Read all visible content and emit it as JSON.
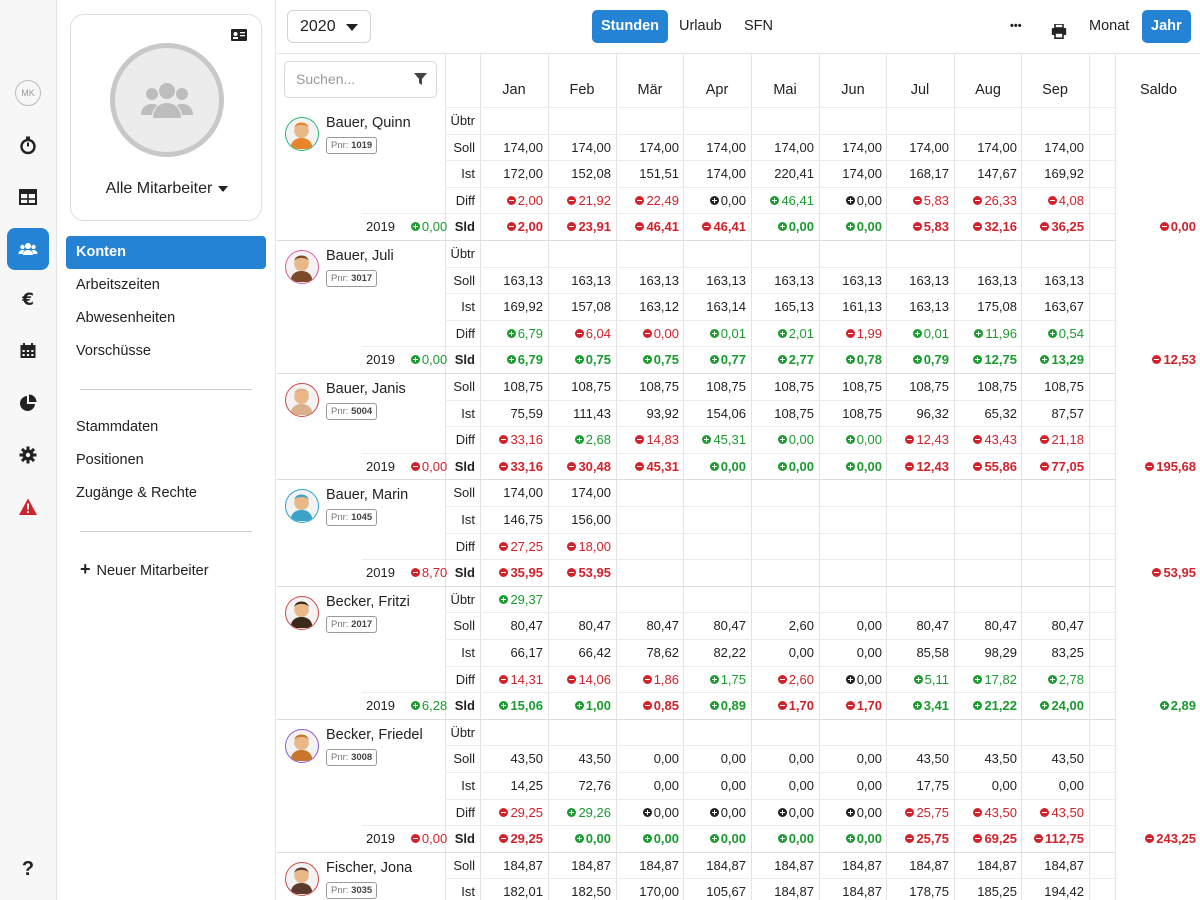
{
  "rail": {
    "avatar_initials": "MK",
    "items": [
      {
        "icon": "stopwatch-icon"
      },
      {
        "icon": "table-icon"
      },
      {
        "icon": "users-icon",
        "active": true
      },
      {
        "icon": "euro-icon"
      },
      {
        "icon": "calendar-icon"
      },
      {
        "icon": "pie-chart-icon"
      },
      {
        "icon": "gear-icon"
      },
      {
        "icon": "warning-icon"
      }
    ],
    "help_label": "?"
  },
  "side": {
    "group_label": "Alle Mitarbeiter",
    "nav": [
      {
        "label": "Konten",
        "active": true
      },
      {
        "label": "Arbeitszeiten"
      },
      {
        "label": "Abwesenheiten"
      },
      {
        "label": "Vorschüsse"
      }
    ],
    "nav2": [
      {
        "label": "Stammdaten"
      },
      {
        "label": "Positionen"
      },
      {
        "label": "Zugänge & Rechte"
      }
    ],
    "new_employee_label": "Neuer Mitarbeiter"
  },
  "topbar": {
    "year": "2020",
    "tabs": [
      {
        "label": "Stunden",
        "active": true
      },
      {
        "label": "Urlaub"
      },
      {
        "label": "SFN"
      }
    ],
    "more_label": "•••",
    "view_month_label": "Monat",
    "view_year_label": "Jahr"
  },
  "table": {
    "search_placeholder": "Suchen...",
    "months": [
      "Jan",
      "Feb",
      "Mär",
      "Apr",
      "Mai",
      "Jun",
      "Jul",
      "Aug",
      "Sep",
      "O"
    ],
    "saldo_label": "Saldo",
    "row_labels": {
      "ubtr": "Übtr",
      "soll": "Soll",
      "ist": "Ist",
      "diff": "Diff",
      "sld": "Sld"
    },
    "employees": [
      {
        "name": "Bauer, Quinn",
        "pnr_label": "Pnr:",
        "pnr": "1019",
        "avatar_color": "#e8852a",
        "prev_year": "2019",
        "prev_value": "0,00",
        "prev_sign": "pos",
        "rows": {
          "ubtr": [],
          "soll": [
            "174,00",
            "174,00",
            "174,00",
            "174,00",
            "174,00",
            "174,00",
            "174,00",
            "174,00",
            "174,00"
          ],
          "ist": [
            "172,00",
            "152,08",
            "151,51",
            "174,00",
            "220,41",
            "174,00",
            "168,17",
            "147,67",
            "169,92"
          ],
          "diff": [
            [
              "neg",
              "2,00"
            ],
            [
              "neg",
              "21,92"
            ],
            [
              "neg",
              "22,49"
            ],
            [
              "neutral",
              "0,00"
            ],
            [
              "pos",
              "46,41"
            ],
            [
              "neutral",
              "0,00"
            ],
            [
              "neg",
              "5,83"
            ],
            [
              "neg",
              "26,33"
            ],
            [
              "neg",
              "4,08"
            ],
            [
              "pos",
              ""
            ]
          ],
          "sld": [
            [
              "neg",
              "2,00"
            ],
            [
              "neg",
              "23,91"
            ],
            [
              "neg",
              "46,41"
            ],
            [
              "neg",
              "46,41"
            ],
            [
              "pos",
              "0,00"
            ],
            [
              "pos",
              "0,00"
            ],
            [
              "neg",
              "5,83"
            ],
            [
              "neg",
              "32,16"
            ],
            [
              "neg",
              "36,25"
            ]
          ]
        },
        "saldo": [
          "neg",
          "0,00"
        ]
      },
      {
        "name": "Bauer, Juli",
        "pnr_label": "Pnr:",
        "pnr": "3017",
        "avatar_color": "#7a4a2a",
        "prev_year": "2019",
        "prev_value": "0,00",
        "prev_sign": "pos",
        "rows": {
          "ubtr": [],
          "soll": [
            "163,13",
            "163,13",
            "163,13",
            "163,13",
            "163,13",
            "163,13",
            "163,13",
            "163,13",
            "163,13"
          ],
          "ist": [
            "169,92",
            "157,08",
            "163,12",
            "163,14",
            "165,13",
            "161,13",
            "163,13",
            "175,08",
            "163,67"
          ],
          "diff": [
            [
              "pos",
              "6,79"
            ],
            [
              "neg",
              "6,04"
            ],
            [
              "neg",
              "0,00"
            ],
            [
              "pos",
              "0,01"
            ],
            [
              "pos",
              "2,01"
            ],
            [
              "neg",
              "1,99"
            ],
            [
              "pos",
              "0,01"
            ],
            [
              "pos",
              "11,96"
            ],
            [
              "pos",
              "0,54"
            ]
          ],
          "sld": [
            [
              "pos",
              "6,79"
            ],
            [
              "pos",
              "0,75"
            ],
            [
              "pos",
              "0,75"
            ],
            [
              "pos",
              "0,77"
            ],
            [
              "pos",
              "2,77"
            ],
            [
              "pos",
              "0,78"
            ],
            [
              "pos",
              "0,79"
            ],
            [
              "pos",
              "12,75"
            ],
            [
              "pos",
              "13,29"
            ]
          ]
        },
        "saldo": [
          "neg",
          "12,53"
        ]
      },
      {
        "name": "Bauer, Janis",
        "pnr_label": "Pnr:",
        "pnr": "5004",
        "avatar_color": "#d9b08c",
        "prev_year": "2019",
        "prev_value": "0,00",
        "prev_sign": "neg",
        "rows": {
          "soll": [
            "108,75",
            "108,75",
            "108,75",
            "108,75",
            "108,75",
            "108,75",
            "108,75",
            "108,75",
            "108,75"
          ],
          "ist": [
            "75,59",
            "111,43",
            "93,92",
            "154,06",
            "108,75",
            "108,75",
            "96,32",
            "65,32",
            "87,57"
          ],
          "diff": [
            [
              "neg",
              "33,16"
            ],
            [
              "pos",
              "2,68"
            ],
            [
              "neg",
              "14,83"
            ],
            [
              "pos",
              "45,31"
            ],
            [
              "pos",
              "0,00"
            ],
            [
              "pos",
              "0,00"
            ],
            [
              "neg",
              "12,43"
            ],
            [
              "neg",
              "43,43"
            ],
            [
              "neg",
              "21,18"
            ]
          ],
          "sld": [
            [
              "neg",
              "33,16"
            ],
            [
              "neg",
              "30,48"
            ],
            [
              "neg",
              "45,31"
            ],
            [
              "pos",
              "0,00"
            ],
            [
              "pos",
              "0,00"
            ],
            [
              "pos",
              "0,00"
            ],
            [
              "neg",
              "12,43"
            ],
            [
              "neg",
              "55,86"
            ],
            [
              "neg",
              "77,05"
            ]
          ]
        },
        "saldo": [
          "neg",
          "195,68"
        ]
      },
      {
        "name": "Bauer, Marin",
        "pnr_label": "Pnr:",
        "pnr": "1045",
        "avatar_color": "#3ba3c8",
        "prev_year": "2019",
        "prev_value": "8,70",
        "prev_sign": "neg",
        "rows": {
          "soll": [
            "174,00",
            "174,00"
          ],
          "ist": [
            "146,75",
            "156,00"
          ],
          "diff": [
            [
              "neg",
              "27,25"
            ],
            [
              "neg",
              "18,00"
            ]
          ],
          "sld": [
            [
              "neg",
              "35,95"
            ],
            [
              "neg",
              "53,95"
            ]
          ]
        },
        "saldo": [
          "neg",
          "53,95"
        ]
      },
      {
        "name": "Becker, Fritzi",
        "pnr_label": "Pnr:",
        "pnr": "2017",
        "avatar_color": "#3a2a1a",
        "prev_year": "2019",
        "prev_value": "6,28",
        "prev_sign": "pos",
        "rows": {
          "ubtr": [
            [
              "pos",
              "29,37"
            ]
          ],
          "soll": [
            "80,47",
            "80,47",
            "80,47",
            "80,47",
            "2,60",
            "0,00",
            "80,47",
            "80,47",
            "80,47"
          ],
          "ist": [
            "66,17",
            "66,42",
            "78,62",
            "82,22",
            "0,00",
            "0,00",
            "85,58",
            "98,29",
            "83,25"
          ],
          "diff": [
            [
              "neg",
              "14,31"
            ],
            [
              "neg",
              "14,06"
            ],
            [
              "neg",
              "1,86"
            ],
            [
              "pos",
              "1,75"
            ],
            [
              "neg",
              "2,60"
            ],
            [
              "neutral",
              "0,00"
            ],
            [
              "pos",
              "5,11"
            ],
            [
              "pos",
              "17,82"
            ],
            [
              "pos",
              "2,78"
            ]
          ],
          "sld": [
            [
              "pos",
              "15,06"
            ],
            [
              "pos",
              "1,00"
            ],
            [
              "neg",
              "0,85"
            ],
            [
              "pos",
              "0,89"
            ],
            [
              "neg",
              "1,70"
            ],
            [
              "neg",
              "1,70"
            ],
            [
              "pos",
              "3,41"
            ],
            [
              "pos",
              "21,22"
            ],
            [
              "pos",
              "24,00"
            ]
          ]
        },
        "saldo": [
          "pos",
          "2,89"
        ]
      },
      {
        "name": "Becker, Friedel",
        "pnr_label": "Pnr:",
        "pnr": "3008",
        "avatar_color": "#c8742a",
        "prev_year": "2019",
        "prev_value": "0,00",
        "prev_sign": "neg",
        "rows": {
          "ubtr": [],
          "soll": [
            "43,50",
            "43,50",
            "0,00",
            "0,00",
            "0,00",
            "0,00",
            "43,50",
            "43,50",
            "43,50"
          ],
          "ist": [
            "14,25",
            "72,76",
            "0,00",
            "0,00",
            "0,00",
            "0,00",
            "17,75",
            "0,00",
            "0,00"
          ],
          "diff": [
            [
              "neg",
              "29,25"
            ],
            [
              "pos",
              "29,26"
            ],
            [
              "neutral",
              "0,00"
            ],
            [
              "neutral",
              "0,00"
            ],
            [
              "neutral",
              "0,00"
            ],
            [
              "neutral",
              "0,00"
            ],
            [
              "neg",
              "25,75"
            ],
            [
              "neg",
              "43,50"
            ],
            [
              "neg",
              "43,50"
            ]
          ],
          "sld": [
            [
              "neg",
              "29,25"
            ],
            [
              "pos",
              "0,00"
            ],
            [
              "pos",
              "0,00"
            ],
            [
              "pos",
              "0,00"
            ],
            [
              "pos",
              "0,00"
            ],
            [
              "pos",
              "0,00"
            ],
            [
              "neg",
              "25,75"
            ],
            [
              "neg",
              "69,25"
            ],
            [
              "neg",
              "112,75"
            ]
          ]
        },
        "saldo": [
          "neg",
          "243,25"
        ]
      },
      {
        "name": "Fischer, Jona",
        "pnr_label": "Pnr:",
        "pnr": "3035",
        "avatar_color": "#5a3a2a",
        "prev_year": "",
        "prev_value": "",
        "prev_sign": "",
        "rows": {
          "soll": [
            "184,87",
            "184,87",
            "184,87",
            "184,87",
            "184,87",
            "184,87",
            "184,87",
            "184,87",
            "184,87"
          ],
          "ist": [
            "182,01",
            "182,50",
            "170,00",
            "105,67",
            "184,87",
            "184,87",
            "178,75",
            "185,25",
            "194,42"
          ]
        },
        "saldo": [
          "",
          ""
        ]
      }
    ]
  },
  "colors": {
    "accent": "#2483d5",
    "positive": "#1a9a2f",
    "negative": "#d0222b"
  }
}
